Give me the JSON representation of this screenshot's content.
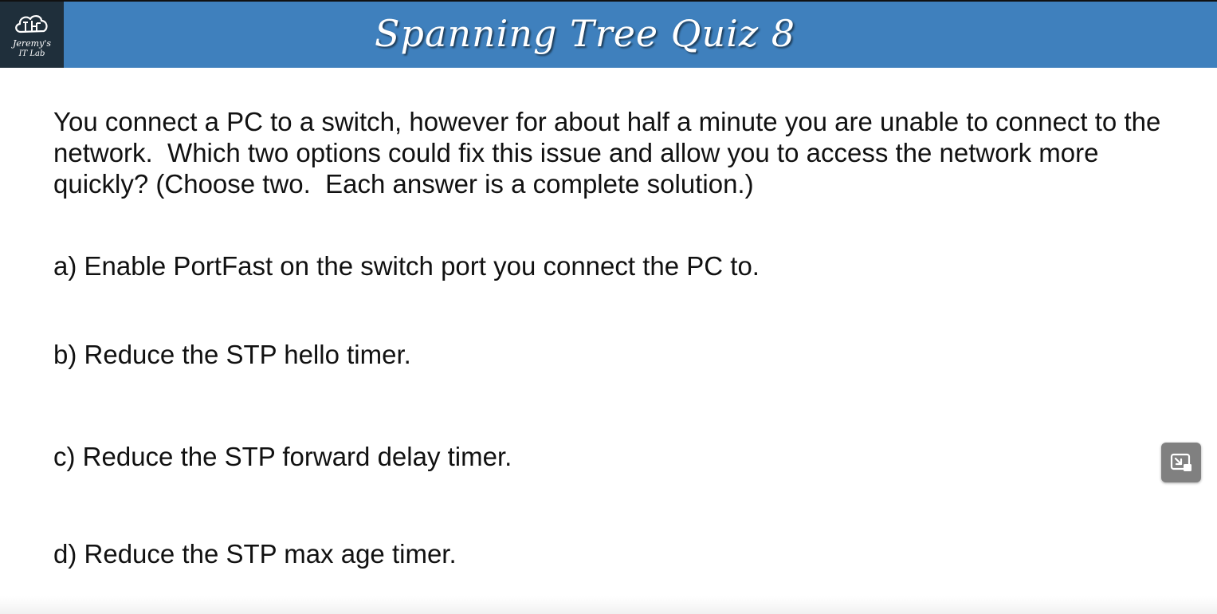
{
  "header": {
    "title": "Spanning Tree Quiz 8",
    "logo": {
      "line1": "Jeremy's",
      "line2": "IT Lab",
      "icon": "cloud-network-logo-icon"
    },
    "background_color": "#3f80bd",
    "logo_background_color": "#1f2f3b"
  },
  "question": {
    "text": "You connect a PC to a switch, however for about half a minute you are unable to connect to the network.  Which two options could fix this issue and allow you to access the network more quickly? (Choose two.  Each answer is a complete solution.)"
  },
  "answers": [
    {
      "label": "a) Enable PortFast on the switch port you connect the PC to."
    },
    {
      "label": "b) Reduce the STP hello timer."
    },
    {
      "label": "c) Reduce the STP forward delay timer."
    },
    {
      "label": "d) Reduce the STP max age timer."
    }
  ],
  "controls": {
    "pip_icon": "picture-in-picture-exit-icon",
    "pip_button_color": "#808080"
  }
}
